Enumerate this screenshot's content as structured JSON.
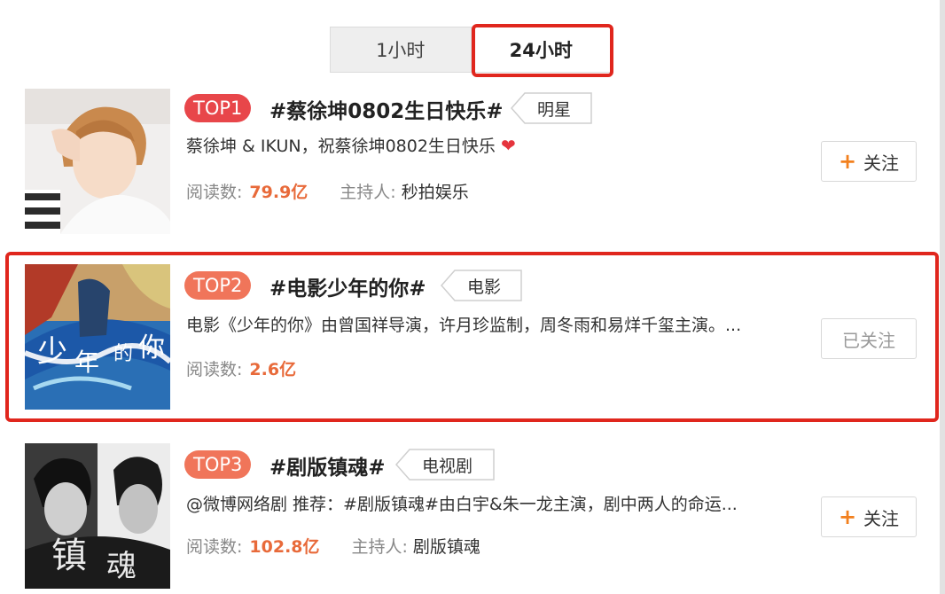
{
  "tabs": [
    {
      "label": "1小时"
    },
    {
      "label": "24小时"
    }
  ],
  "topics": [
    {
      "rank": "TOP1",
      "title": "#蔡徐坤0802生日快乐#",
      "tag": "明星",
      "description": "蔡徐坤 & IKUN，祝蔡徐坤0802生日快乐",
      "heart": "❤",
      "reads_label": "阅读数:",
      "reads_value": "79.9亿",
      "host_label": "主持人:",
      "host_value": "秒拍娱乐",
      "follow_plus": "+",
      "follow_label": "关注"
    },
    {
      "rank": "TOP2",
      "title": "#电影少年的你#",
      "tag": "电影",
      "description": "电影《少年的你》由曾国祥导演，许月珍监制，周冬雨和易烊千玺主演。...",
      "reads_label": "阅读数:",
      "reads_value": "2.6亿",
      "follow_label": "已关注"
    },
    {
      "rank": "TOP3",
      "title": "#剧版镇魂#",
      "tag": "电视剧",
      "description": "@微博网络剧 推荐：#剧版镇魂#由白宇&朱一龙主演，剧中两人的命运...",
      "reads_label": "阅读数:",
      "reads_value": "102.8亿",
      "host_label": "主持人:",
      "host_value": "剧版镇魂",
      "follow_plus": "+",
      "follow_label": "关注"
    }
  ],
  "colors": {
    "highlight_red": "#e0261d",
    "rank1": "#e8464a",
    "rank_other": "#f0755a",
    "read_count": "#e86a3a",
    "plus_orange": "#f2801e"
  }
}
